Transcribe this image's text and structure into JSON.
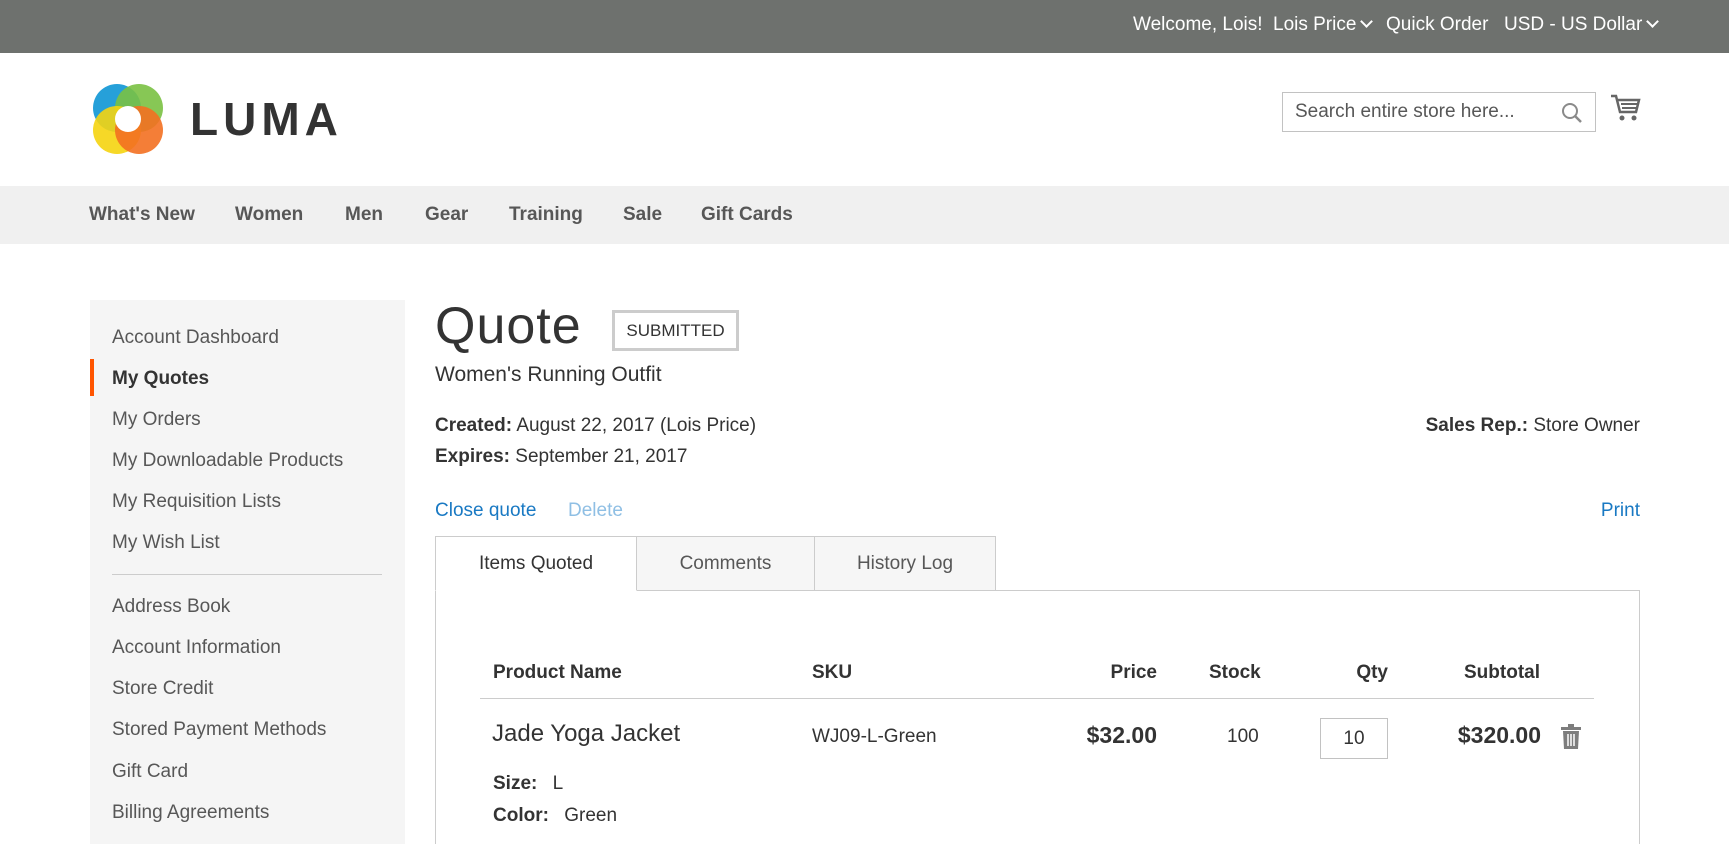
{
  "topbar": {
    "welcome": "Welcome, Lois!",
    "account": "Lois Price",
    "quick_order": "Quick Order",
    "currency": "USD - US Dollar"
  },
  "header": {
    "brand": "LUMA",
    "search_placeholder": "Search entire store here..."
  },
  "nav": [
    "What's New",
    "Women",
    "Men",
    "Gear",
    "Training",
    "Sale",
    "Gift Cards"
  ],
  "sidebar": {
    "items": [
      {
        "label": "Account Dashboard"
      },
      {
        "label": "My Quotes",
        "active": true
      },
      {
        "label": "My Orders"
      },
      {
        "label": "My Downloadable Products"
      },
      {
        "label": "My Requisition Lists"
      },
      {
        "label": "My Wish List"
      },
      {
        "label": "Address Book"
      },
      {
        "label": "Account Information"
      },
      {
        "label": "Store Credit"
      },
      {
        "label": "Stored Payment Methods"
      },
      {
        "label": "Gift Card"
      },
      {
        "label": "Billing Agreements"
      }
    ]
  },
  "quote": {
    "title": "Quote",
    "status": "SUBMITTED",
    "name": "Women's Running Outfit",
    "created_label": "Created:",
    "created_value": "August 22, 2017 (Lois Price)",
    "expires_label": "Expires:",
    "expires_value": "September 21, 2017",
    "sales_rep_label": "Sales Rep.:",
    "sales_rep_value": "Store Owner",
    "actions": {
      "close": "Close quote",
      "delete": "Delete",
      "print": "Print"
    }
  },
  "tabs": [
    "Items Quoted",
    "Comments",
    "History Log"
  ],
  "items_table": {
    "headers": [
      "Product Name",
      "SKU",
      "Price",
      "Stock",
      "Qty",
      "Subtotal"
    ],
    "rows": [
      {
        "product_name": "Jade Yoga Jacket",
        "sku": "WJ09-L-Green",
        "price": "$32.00",
        "stock": "100",
        "qty": "10",
        "subtotal": "$320.00",
        "options": [
          {
            "label": "Size:",
            "value": "L"
          },
          {
            "label": "Color:",
            "value": "Green"
          }
        ]
      }
    ]
  },
  "colors": {
    "topbar_bg": "#6e716e",
    "nav_bg": "#f0f0f0",
    "link": "#1979c3",
    "active_accent": "#ff5501"
  }
}
